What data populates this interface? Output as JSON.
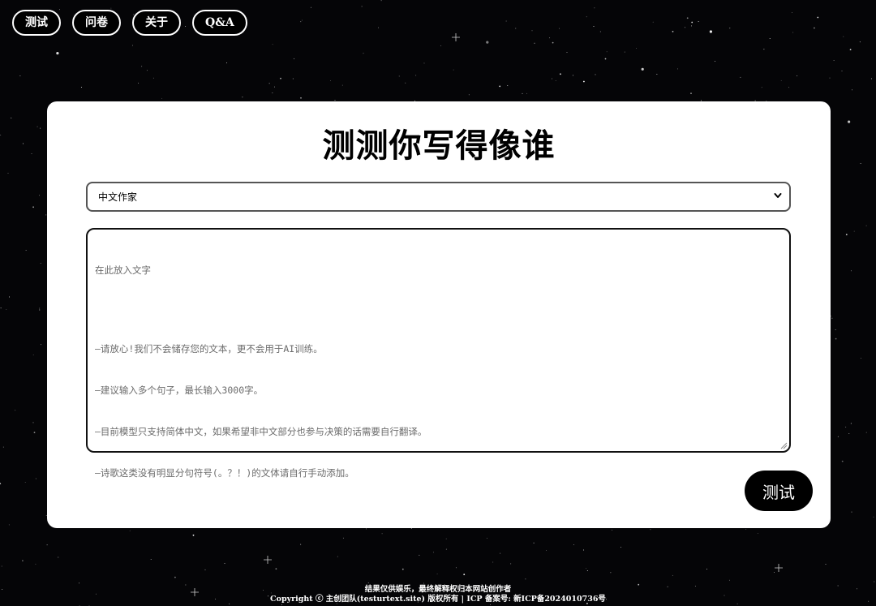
{
  "nav": {
    "items": [
      {
        "label": "测试"
      },
      {
        "label": "问卷"
      },
      {
        "label": "关于"
      },
      {
        "label": "Q&A"
      }
    ]
  },
  "main": {
    "title": "测测你写得像谁",
    "select": {
      "value": "中文作家"
    },
    "textarea": {
      "placeholder_title": "在此放入文字",
      "placeholder_lines": [
        "—请放心!我们不会储存您的文本，更不会用于AI训练。",
        "—建议输入多个句子，最长输入3000字。",
        "—目前模型只支持简体中文，如果希望非中文部分也参与决策的话需要自行翻译。",
        "—诗歌这类没有明显分句符号(。？！)的文体请自行手动添加。"
      ]
    },
    "submit_label": "测试"
  },
  "footer": {
    "line1": "结果仅供娱乐，最终解释权归本网站创作者",
    "line2": "Copyright ⓒ 主创团队(testurtext.site) 版权所有 | ICP 备案号: 新ICP备2024010736号"
  },
  "icons": {
    "select_chevron": "chevron-down-icon",
    "resize": "resize-grip-icon"
  },
  "colors": {
    "background": "#050507",
    "card": "#ffffff",
    "button": "#000000"
  }
}
